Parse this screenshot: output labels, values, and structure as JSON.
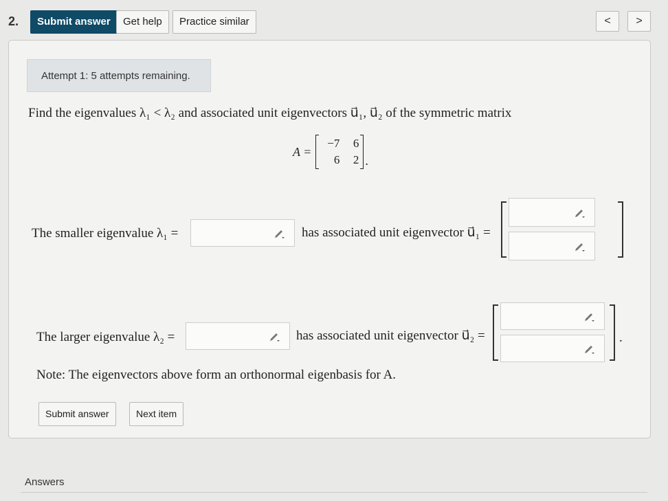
{
  "question_number": "2.",
  "toolbar": {
    "submit_label": "Submit answer",
    "help_label": "Get help",
    "practice_label": "Practice similar",
    "prev_label": "<",
    "next_label": ">"
  },
  "attempt_text": "Attempt 1: 5 attempts remaining.",
  "prompt": "Find the eigenvalues λ₁ < λ₂ and associated unit eigenvectors u⃗₁, u⃗₂ of the symmetric matrix",
  "matrix": {
    "label": "A =",
    "cells": [
      "−7",
      "6",
      "6",
      "2"
    ],
    "trailing": "."
  },
  "row1": {
    "label": "The smaller eigenvalue λ₁ =",
    "vector_label": "has associated unit eigenvector u⃗₁ =",
    "eigenvalue_value": "",
    "vector_values": [
      "",
      ""
    ]
  },
  "row2": {
    "label": "The larger eigenvalue λ₂ =",
    "vector_label": "has associated unit eigenvector u⃗₂ =",
    "eigenvalue_value": "",
    "vector_values": [
      "",
      ""
    ],
    "trailing": "."
  },
  "note": "Note: The eigenvectors above form an orthonormal eigenbasis for A.",
  "footer_buttons": {
    "submit_label": "Submit answer",
    "next_item_label": "Next item"
  },
  "answers_label": "Answers",
  "colors": {
    "primary_button": "#0f4a66",
    "card_background": "#f3f3f1",
    "attempt_banner": "#dfe3e6"
  }
}
